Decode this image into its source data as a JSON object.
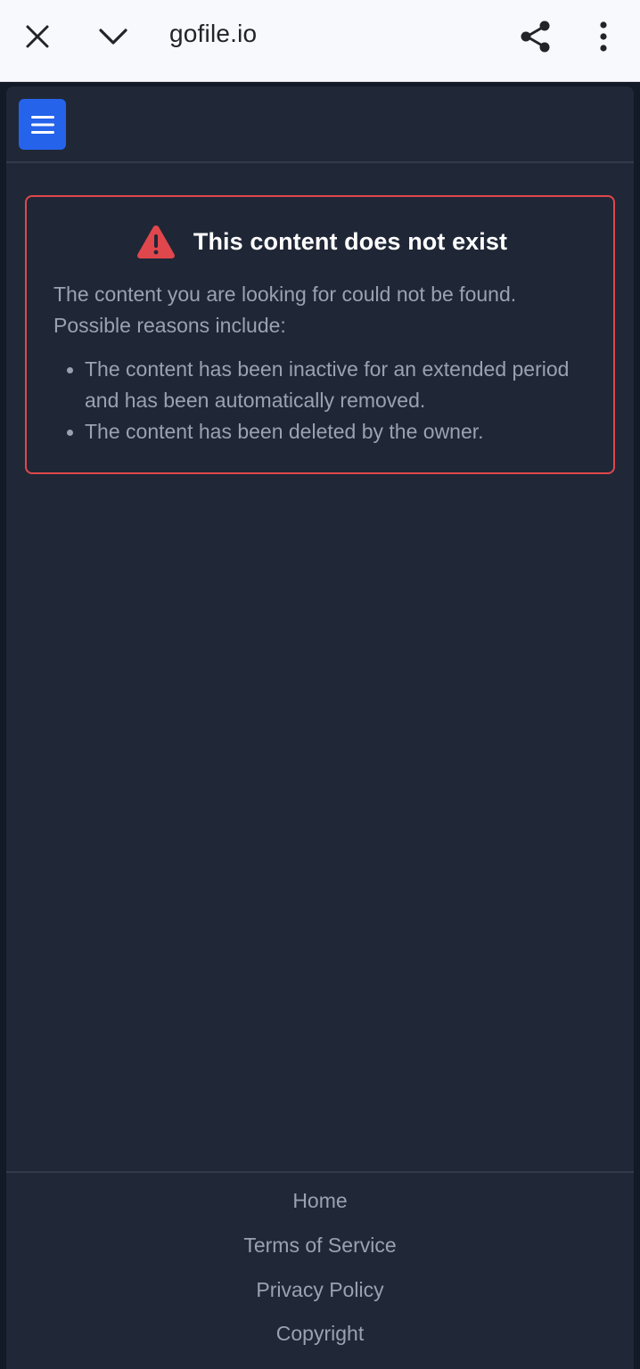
{
  "browser": {
    "title": "gofile.io",
    "icons": {
      "close": "close-icon",
      "minimize": "chevron-down-icon",
      "share": "share-icon",
      "more": "more-vertical-icon"
    }
  },
  "header": {
    "menu_icon": "hamburger-menu-icon",
    "menu_color": "#2563eb"
  },
  "error": {
    "icon": "warning-triangle-icon",
    "title": "This content does not exist",
    "description": "The content you are looking for could not be found. Possible reasons include:",
    "reasons": [
      "The content has been inactive for an extended period and has been automatically removed.",
      "The content has been deleted by the owner."
    ],
    "border_color": "#e0474c"
  },
  "footer": {
    "links": [
      "Home",
      "Terms of Service",
      "Privacy Policy",
      "Copyright"
    ]
  }
}
